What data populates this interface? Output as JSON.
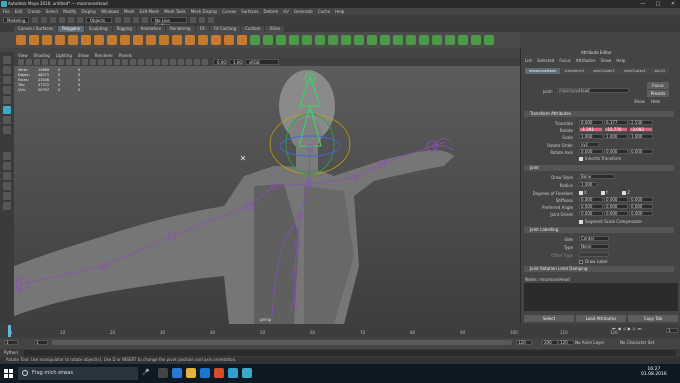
{
  "window": {
    "title": "Autodesk Maya 2016: untitled*  ---  missmonsHead",
    "controls": [
      "—",
      "□",
      "✕"
    ]
  },
  "menubar": [
    "File",
    "Edit",
    "Create",
    "Select",
    "Modify",
    "Display",
    "Windows",
    "Mesh",
    "Edit Mesh",
    "Mesh Tools",
    "Mesh Display",
    "Curves",
    "Surfaces",
    "Deform",
    "UV",
    "Generate",
    "Cache",
    "Help"
  ],
  "statusline": {
    "mode": "Modeling",
    "objects": "Objects",
    "live": "No Live Surface"
  },
  "shelf_tabs": [
    {
      "label": "Curves / Surfaces",
      "active": false
    },
    {
      "label": "Polygons",
      "active": true
    },
    {
      "label": "Sculpting",
      "active": false
    },
    {
      "label": "Rigging",
      "active": false
    },
    {
      "label": "Animation",
      "active": false
    },
    {
      "label": "Rendering",
      "active": false
    },
    {
      "label": "FX",
      "active": false
    },
    {
      "label": "FX Caching",
      "active": false
    },
    {
      "label": "Custom",
      "active": false
    },
    {
      "label": "XGen",
      "active": false
    }
  ],
  "viewport": {
    "menu": [
      "View",
      "Shading",
      "Lighting",
      "Show",
      "Renderer",
      "Panels"
    ],
    "colorspace": "sRGB gamma",
    "field1": "0.00",
    "field2": "1.00",
    "hud": [
      {
        "label": "Verts:",
        "a": "14669",
        "b": "0",
        "c": "0"
      },
      {
        "label": "Edges:",
        "a": "46271",
        "b": "0",
        "c": "0"
      },
      {
        "label": "Faces:",
        "a": "23046",
        "b": "0",
        "c": "0"
      },
      {
        "label": "Tris:",
        "a": "37372",
        "b": "0",
        "c": "0"
      },
      {
        "label": "UVs:",
        "a": "20797",
        "b": "0",
        "c": "0"
      }
    ],
    "persp_label": "persp"
  },
  "attribute_editor": {
    "panel_title": "Attribute Editor",
    "menu": [
      "List",
      "Selected",
      "Focus",
      "Attributes",
      "Show",
      "Help"
    ],
    "node_tabs": [
      "missmonsHead",
      "transform1",
      "skinCluster1",
      "skinCluster2",
      "skinCl"
    ],
    "joint_label": "joint:",
    "joint_value": "missmonsHead",
    "focus_btn": "Focus",
    "presets_btn": "Presets",
    "show_label": "Show",
    "hide_label": "Hide",
    "sections": {
      "transform": "Transform Attributes",
      "joint": "Joint",
      "labelling": "Joint Labelling",
      "rotation_limit": "Joint Rotation Limit Damping"
    },
    "transform": [
      {
        "label": "Translate",
        "x": "0.000",
        "y": "6.377",
        "z": "2.530"
      },
      {
        "label": "Rotate",
        "x": "-1.291",
        "y": "-15.770",
        "z": "-3.092"
      },
      {
        "label": "Scale",
        "x": "1.000",
        "y": "1.000",
        "z": "1.000"
      }
    ],
    "rotate_order_label": "Rotate Order",
    "rotate_order": "xyz",
    "rotate_axis_label": "Rotate Axis",
    "rotate_axis": [
      "0.000",
      "0.000",
      "0.000"
    ],
    "inherits_transform": "Inherits Transform",
    "draw_style_label": "Draw Style",
    "draw_style": "Bone",
    "radius_label": "Radius",
    "radius": "1.000",
    "dof_label": "Degrees of Freedom",
    "dof": [
      "X",
      "Y",
      "Z"
    ],
    "stiffness_label": "Stiffness",
    "stiffness": [
      "0.000",
      "0.000",
      "0.000"
    ],
    "preferred_label": "Preferred Angle",
    "preferred": [
      "0.000",
      "0.000",
      "0.000"
    ],
    "orient_label": "Joint Orient",
    "orient": [
      "0.000",
      "0.000",
      "0.000"
    ],
    "segment_scale": "Segment Scale Compensate",
    "side_label": "Side",
    "side": "Center",
    "type_label": "Type",
    "type": "None",
    "other_type_label": "Other Type",
    "draw_label": "Draw Label",
    "notes_label": "Notes:",
    "notes_value": "missmonsHead",
    "buttons": [
      "Select",
      "Load Attributes",
      "Copy Tab"
    ]
  },
  "timeline": {
    "ticks": [
      "1",
      "10",
      "20",
      "30",
      "40",
      "50",
      "60",
      "70",
      "80",
      "90",
      "100",
      "110",
      "120"
    ],
    "current_frame": "1"
  },
  "rangebar": {
    "start": "1",
    "start2": "1",
    "end": "120",
    "end2": "200",
    "end3": "120",
    "anim_layer": "No Anim Layer",
    "char_set": "No Character Set"
  },
  "mel": {
    "label": "Python"
  },
  "helpline": "Rotate Tool: Use manipulator to rotate object(s). Use D or INSERT to change the pivot position and axis orientation.",
  "taskbar": {
    "search": "Frag mich etwas",
    "time": "16:27",
    "date": "01.08.2016"
  },
  "colors": {
    "accent": "#5d6b74",
    "rotate_field": "#d9687a",
    "skeleton": "#8a4fb8",
    "selected_joint": "#39d36e"
  }
}
